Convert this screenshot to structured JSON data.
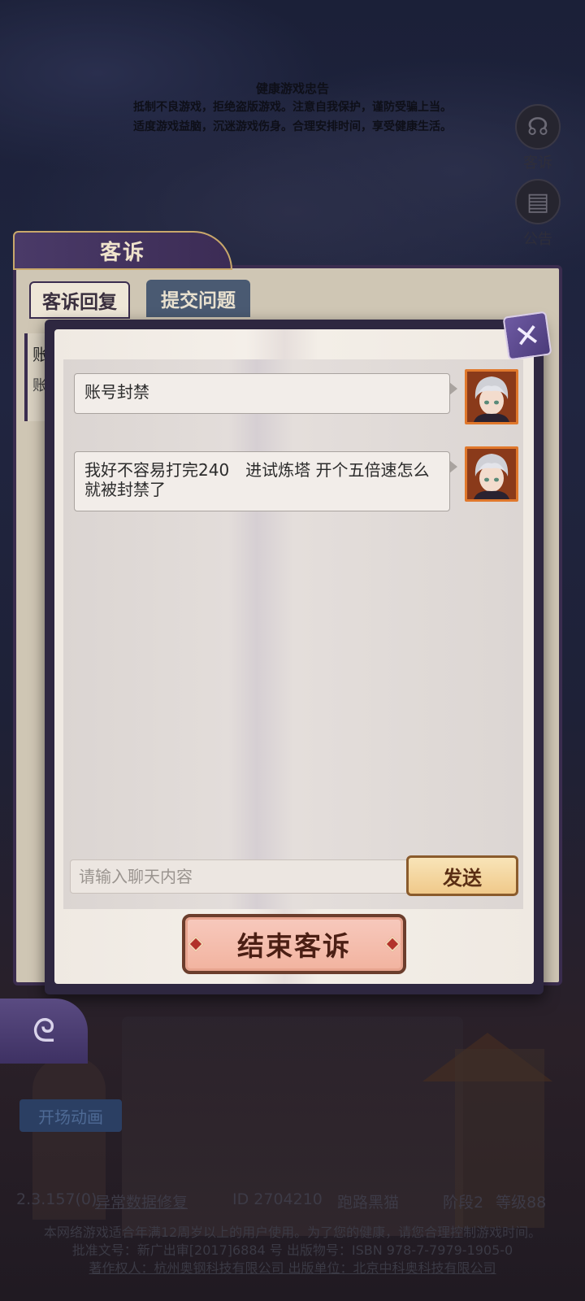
{
  "notice": {
    "title": "健康游戏忠告",
    "line1": "抵制不良游戏，拒绝盗版游戏。注意自我保护，谨防受骗上当。",
    "line2": "适度游戏益脑，沉迷游戏伤身。合理安排时间，享受健康生活。"
  },
  "side": {
    "complaint_label": "客诉",
    "announce_label": "公告"
  },
  "back_window": {
    "title": "客诉",
    "tabs": [
      "客诉回复",
      "提交问题"
    ],
    "row_char_1": "账",
    "row_char_2": "账"
  },
  "chat": {
    "messages": [
      {
        "text": "账号封禁"
      },
      {
        "text": "我好不容易打完240　进试炼塔 开个五倍速怎么就被封禁了"
      }
    ],
    "input": {
      "value": "",
      "placeholder": "请输入聊天内容"
    },
    "send_label": "发送",
    "end_label": "结束客诉"
  },
  "bottom": {
    "intro_label": "开场动画",
    "version": "2.3.157(0)",
    "repair_link": "异常数据修复",
    "id_text": "ID 2704210",
    "name": "跑路黑猫",
    "stage": "阶段2",
    "level": "等级88",
    "footer1": "本网络游戏适合年满12周岁以上的用户使用。为了您的健康，请您合理控制游戏时间。",
    "footer2": "批准文号：新广出审[2017]6884 号  出版物号：ISBN 978-7-7979-1905-0",
    "footer3": "著作权人：杭州奥钢科技有限公司  出版单位：北京中科奥科技有限公司"
  },
  "colors": {
    "modal_frame": "#2e2740",
    "avatar_border": "#e0782c",
    "end_button": "#f2b39f",
    "send_button": "#f0c98a"
  }
}
